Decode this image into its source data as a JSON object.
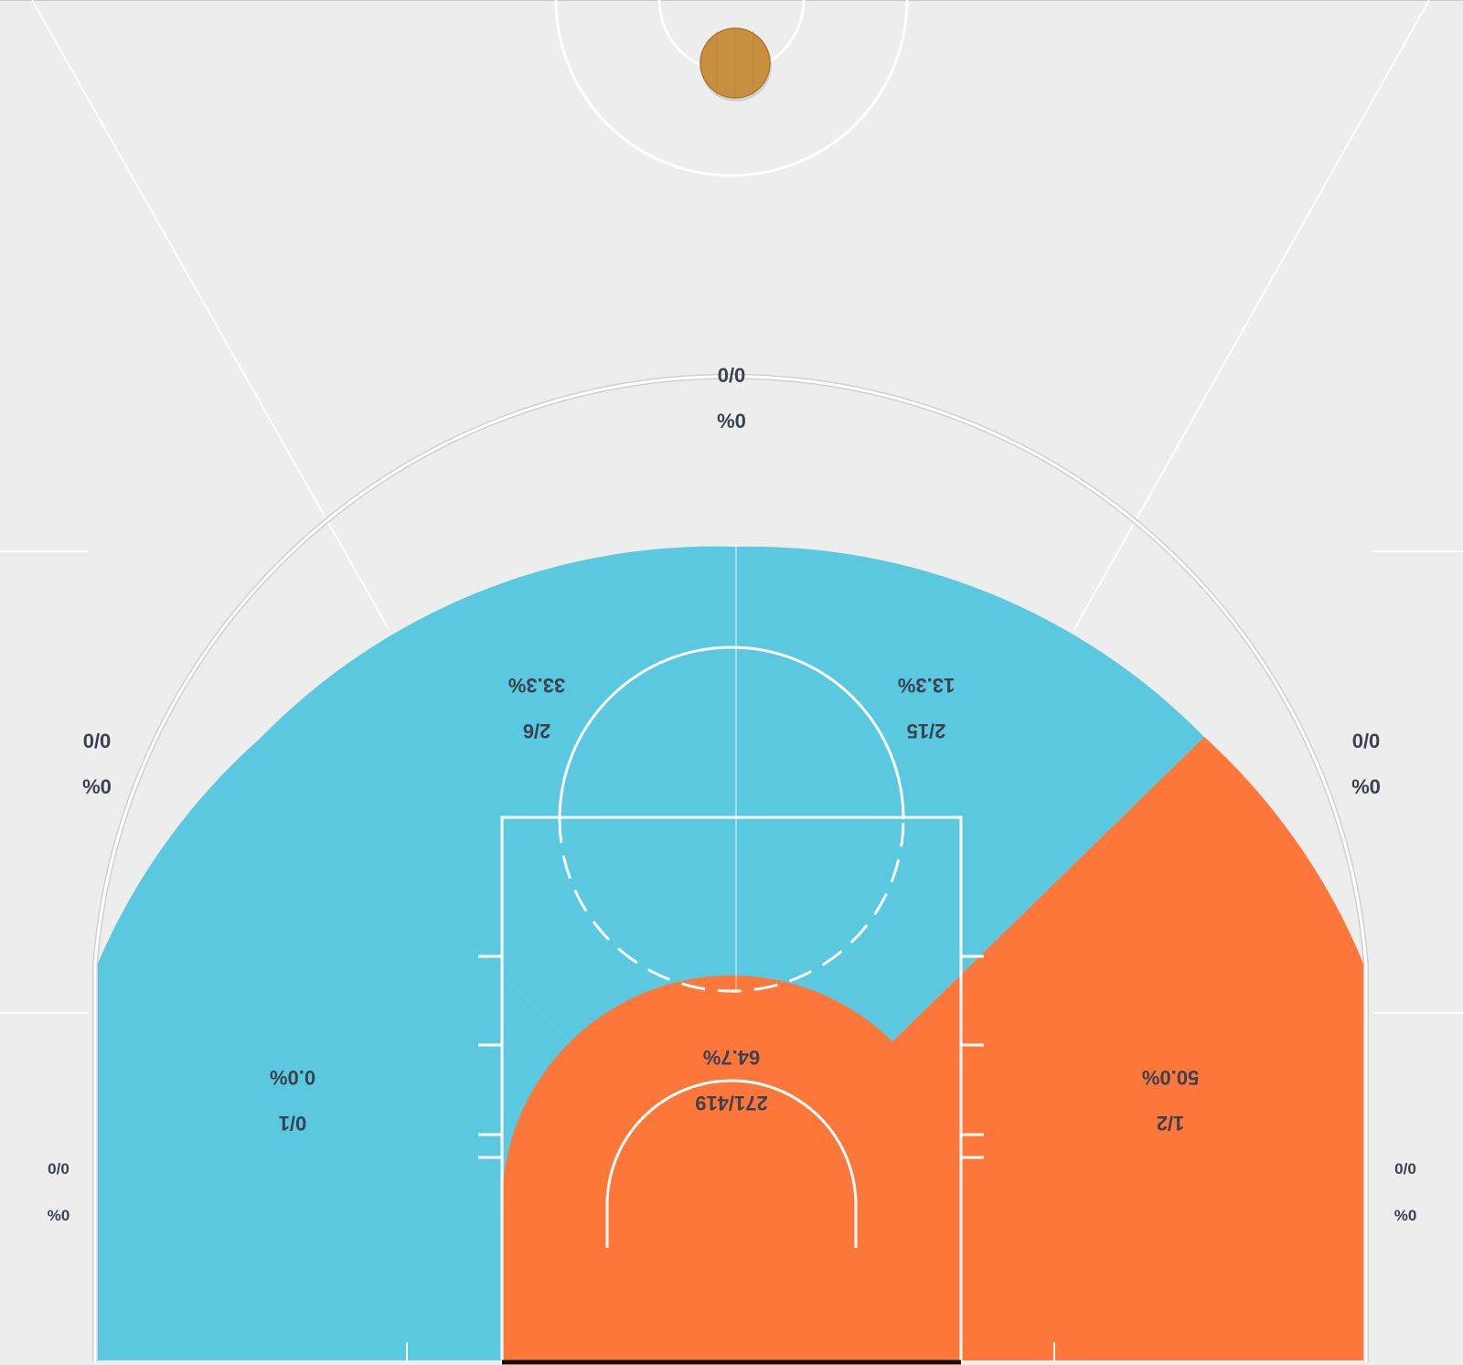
{
  "colors": {
    "background": "#ededed",
    "cold_zone": "#5ac9df",
    "hot_zone": "#fd763a",
    "court_line": "#ffffff",
    "zone_text": "#3b4150",
    "ball": "#c78f3e"
  },
  "zones": {
    "paint": {
      "made_att": "271/419",
      "pct": "64.7%",
      "level": "hot"
    },
    "mid_left": {
      "made_att": "2/6",
      "pct": "33.3%",
      "level": "cold"
    },
    "mid_right": {
      "made_att": "2/15",
      "pct": "13.3%",
      "level": "cold"
    },
    "baseline_left": {
      "made_att": "0/1",
      "pct": "0.0%",
      "level": "cold"
    },
    "baseline_right": {
      "made_att": "1/2",
      "pct": "50.0%",
      "level": "hot"
    },
    "three_top": {
      "made_att": "0/0",
      "pct": "%0"
    },
    "three_left": {
      "made_att": "0/0",
      "pct": "%0"
    },
    "three_right": {
      "made_att": "0/0",
      "pct": "%0"
    },
    "corner_left": {
      "made_att": "0/0",
      "pct": "%0"
    },
    "corner_right": {
      "made_att": "0/0",
      "pct": "%0"
    }
  },
  "ball_icon": "basketball-icon"
}
